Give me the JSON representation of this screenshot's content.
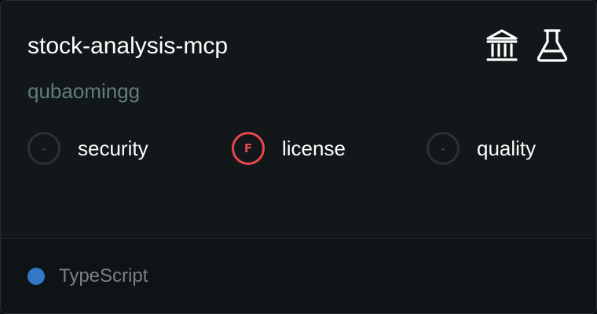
{
  "server": {
    "name": "stock-analysis-mcp",
    "owner": "qubaomingg"
  },
  "icons": [
    {
      "name": "institution-icon"
    },
    {
      "name": "flask-icon"
    }
  ],
  "scores": [
    {
      "key": "security",
      "grade": "-",
      "label": "security"
    },
    {
      "key": "license",
      "grade": "F",
      "label": "license"
    },
    {
      "key": "quality",
      "grade": "-",
      "label": "quality"
    }
  ],
  "footer": {
    "language": "TypeScript",
    "language_color": "#3178c6"
  },
  "colors": {
    "background": "#121719",
    "owner_text": "#5f7e74",
    "fail_grade": "#e5484d",
    "muted_ring": "#2b3135"
  }
}
